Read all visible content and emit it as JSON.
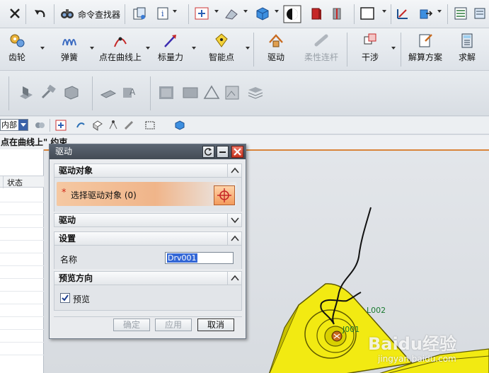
{
  "toolbar_top": {
    "command_finder_label": "命令查找器"
  },
  "toolbar_main": {
    "gear": "齿轮",
    "spring": "弹簧",
    "point_on_curve": "点在曲线上",
    "vector_force": "标量力",
    "smart_point": "智能点",
    "driver": "驱动",
    "flexible_link": "柔性连杆",
    "interference": "干涉",
    "solution": "解算方案",
    "solve": "求解"
  },
  "filter": {
    "value": "内部"
  },
  "left_panel": {
    "header": "点在曲线上\" 约束",
    "column_status": "状态"
  },
  "dialog": {
    "title": "驱动",
    "section_driver_object": "驱动对象",
    "select_driver_object": "选择驱动对象 (0)",
    "required_marker": "*",
    "section_driver": "驱动",
    "section_settings": "设置",
    "name_label": "名称",
    "name_value": "Drv001",
    "section_preview_direction": "预览方向",
    "preview_label": "预览",
    "preview_checked": true,
    "ok_button": "确定",
    "apply_button": "应用",
    "cancel_button": "取消"
  },
  "viewport": {
    "label_l002": "L002",
    "label_j001": "J001"
  },
  "watermark": {
    "brand": "Baidu经验",
    "url": "jingyan.baidu.com"
  },
  "colors": {
    "title_bar": "#4b545f",
    "accent_orange": "#f0b58a",
    "model_yellow": "#f2ea12",
    "viewport_top_border": "#d9843a"
  }
}
